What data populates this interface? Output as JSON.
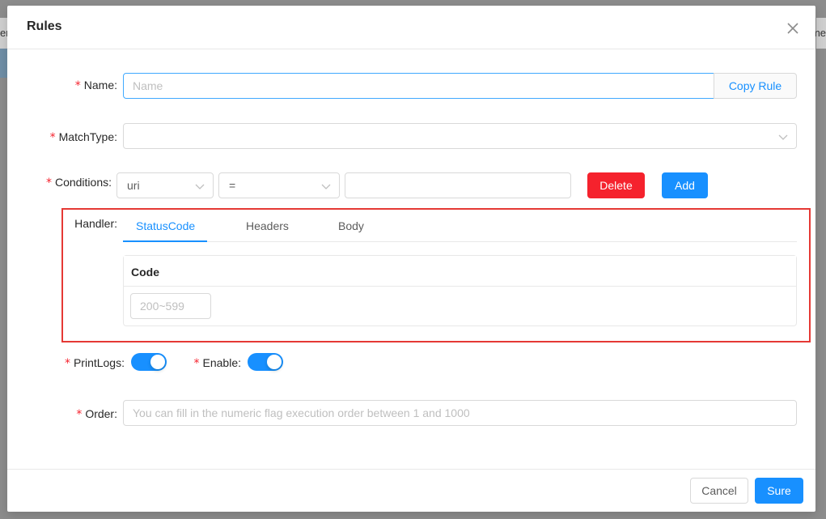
{
  "background": {
    "left_fragment": "en",
    "right_fragment": "me"
  },
  "modal": {
    "title": "Rules",
    "close_icon": "close-icon"
  },
  "form": {
    "name": {
      "label": "Name:",
      "placeholder": "Name",
      "value": "",
      "copy_button": "Copy Rule"
    },
    "match_type": {
      "label": "MatchType:",
      "value": ""
    },
    "conditions": {
      "label": "Conditions:",
      "param_type": "uri",
      "operator": "=",
      "value": "",
      "delete_button": "Delete",
      "add_button": "Add"
    },
    "handler": {
      "label": "Handler:",
      "tabs": [
        {
          "label": "StatusCode",
          "active": true
        },
        {
          "label": "Headers",
          "active": false
        },
        {
          "label": "Body",
          "active": false
        }
      ],
      "table_header": "Code",
      "code_placeholder": "200~599",
      "code_value": ""
    },
    "print_logs": {
      "label": "PrintLogs:",
      "on": true
    },
    "enable": {
      "label": "Enable:",
      "on": true
    },
    "order": {
      "label": "Order:",
      "placeholder": "You can fill in the numeric flag execution order between 1 and 1000",
      "value": ""
    }
  },
  "footer": {
    "cancel": "Cancel",
    "sure": "Sure"
  },
  "colors": {
    "primary": "#1890ff",
    "danger": "#f5222d",
    "highlight_border": "#e53935",
    "required": "#f5222d"
  }
}
